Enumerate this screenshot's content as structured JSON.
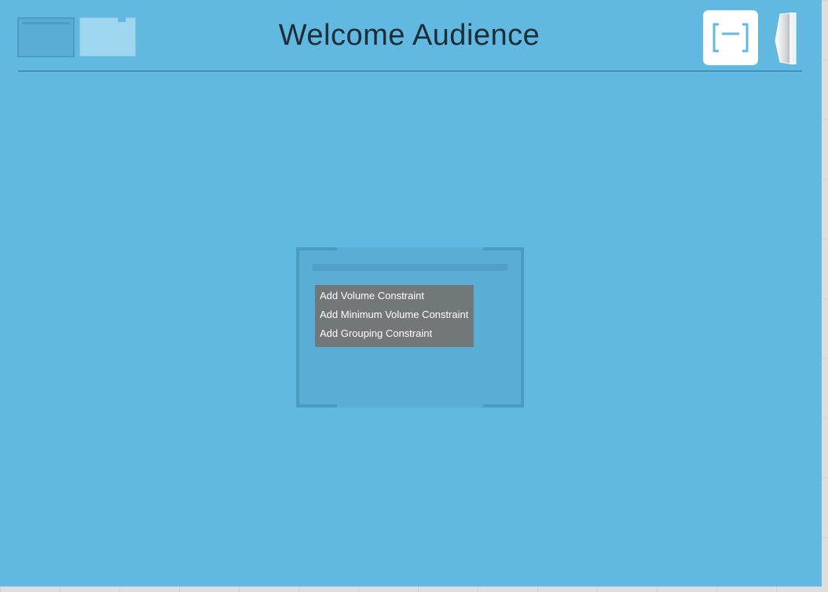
{
  "header": {
    "title": "Welcome Audience",
    "fullscreen_icon": "fullscreen-bracket-icon",
    "collapse_icon": "panel-collapse-icon"
  },
  "thumbnails": [
    {
      "name": "slide-thumbnail-1"
    },
    {
      "name": "slide-thumbnail-2"
    }
  ],
  "context_menu": {
    "items": [
      {
        "label": "Add Volume Constraint"
      },
      {
        "label": "Add Minimum Volume Constraint"
      },
      {
        "label": "Add Grouping Constraint"
      }
    ]
  },
  "colors": {
    "background": "#61b8e0",
    "modal": "#5aadd5",
    "menu": "#727779",
    "title_text": "#1f2d37",
    "icon_accent": "#61b8e0"
  }
}
